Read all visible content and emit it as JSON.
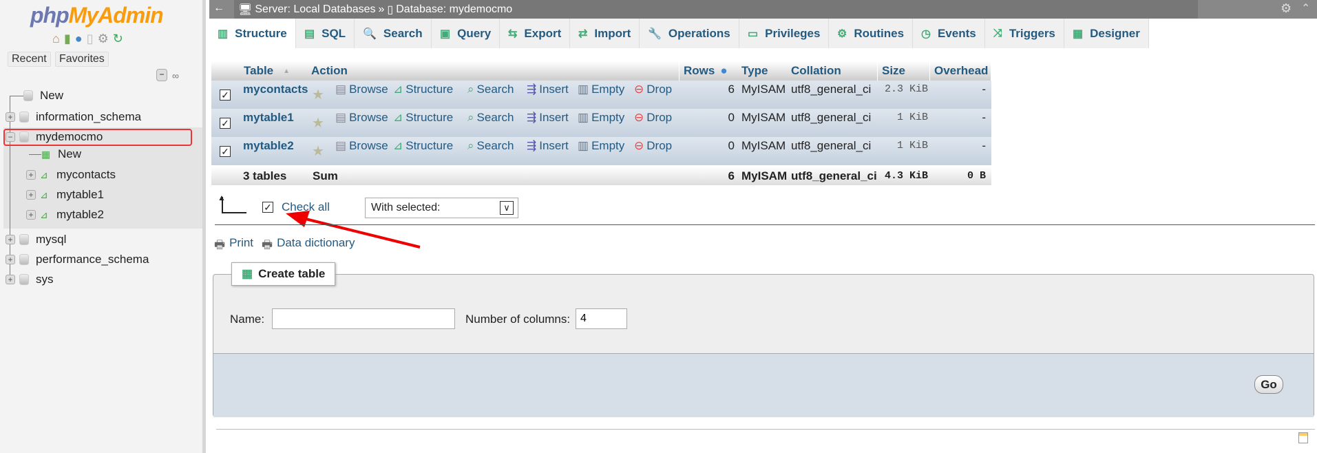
{
  "sidebar": {
    "logo_php": "php",
    "logo_myadmin": "MyAdmin",
    "recent": "Recent",
    "favorites": "Favorites",
    "tree": [
      {
        "label": "New",
        "level": 0,
        "icon": "new-db-icon"
      },
      {
        "label": "information_schema",
        "level": 0,
        "icon": "database-icon"
      },
      {
        "label": "mydemocmo",
        "level": 0,
        "icon": "database-icon",
        "expanded": true,
        "highlighted": true
      },
      {
        "label": "New",
        "level": 1,
        "icon": "new-table-icon"
      },
      {
        "label": "mycontacts",
        "level": 1,
        "icon": "table-icon"
      },
      {
        "label": "mytable1",
        "level": 1,
        "icon": "table-icon"
      },
      {
        "label": "mytable2",
        "level": 1,
        "icon": "table-icon"
      },
      {
        "label": "mysql",
        "level": 0,
        "icon": "database-icon"
      },
      {
        "label": "performance_schema",
        "level": 0,
        "icon": "database-icon"
      },
      {
        "label": "sys",
        "level": 0,
        "icon": "database-icon"
      }
    ]
  },
  "breadcrumb": {
    "server": "Server: Local Databases",
    "sep": "»",
    "database": "Database: mydemocmo"
  },
  "tabs": [
    {
      "label": "Structure",
      "icon": "structure-icon",
      "active": true
    },
    {
      "label": "SQL",
      "icon": "sql-icon"
    },
    {
      "label": "Search",
      "icon": "search-icon"
    },
    {
      "label": "Query",
      "icon": "query-icon"
    },
    {
      "label": "Export",
      "icon": "export-icon"
    },
    {
      "label": "Import",
      "icon": "import-icon"
    },
    {
      "label": "Operations",
      "icon": "wrench-icon"
    },
    {
      "label": "Privileges",
      "icon": "privileges-icon"
    },
    {
      "label": "Routines",
      "icon": "routines-icon"
    },
    {
      "label": "Events",
      "icon": "clock-icon"
    },
    {
      "label": "Triggers",
      "icon": "triggers-icon"
    },
    {
      "label": "Designer",
      "icon": "designer-icon"
    }
  ],
  "table": {
    "headers": {
      "table": "Table",
      "action": "Action",
      "rows": "Rows",
      "type": "Type",
      "collation": "Collation",
      "size": "Size",
      "overhead": "Overhead"
    },
    "actions": [
      "Browse",
      "Structure",
      "Search",
      "Insert",
      "Empty",
      "Drop"
    ],
    "rows": [
      {
        "name": "mycontacts",
        "rows": "6",
        "type": "MyISAM",
        "collation": "utf8_general_ci",
        "size": "2.3 KiB",
        "overhead": "-",
        "checked": true
      },
      {
        "name": "mytable1",
        "rows": "0",
        "type": "MyISAM",
        "collation": "utf8_general_ci",
        "size": "1 KiB",
        "overhead": "-",
        "checked": true
      },
      {
        "name": "mytable2",
        "rows": "0",
        "type": "MyISAM",
        "collation": "utf8_general_ci",
        "size": "1 KiB",
        "overhead": "-",
        "checked": true
      }
    ],
    "sum": {
      "name": "3 tables",
      "action": "Sum",
      "rows": "6",
      "type": "MyISAM",
      "collation": "utf8_general_ci",
      "size": "4.3 KiB",
      "overhead": "0 B"
    }
  },
  "bulk": {
    "check_all": "Check all",
    "with_selected": "With selected:"
  },
  "links": {
    "print": "Print",
    "data_dictionary": "Data dictionary"
  },
  "create": {
    "legend": "Create table",
    "name_label": "Name:",
    "name_value": "",
    "columns_label": "Number of columns:",
    "columns_value": "4",
    "go": "Go"
  },
  "colors": {
    "link": "#235a81",
    "highlight_box": "#e33",
    "arrow": "#e00"
  }
}
